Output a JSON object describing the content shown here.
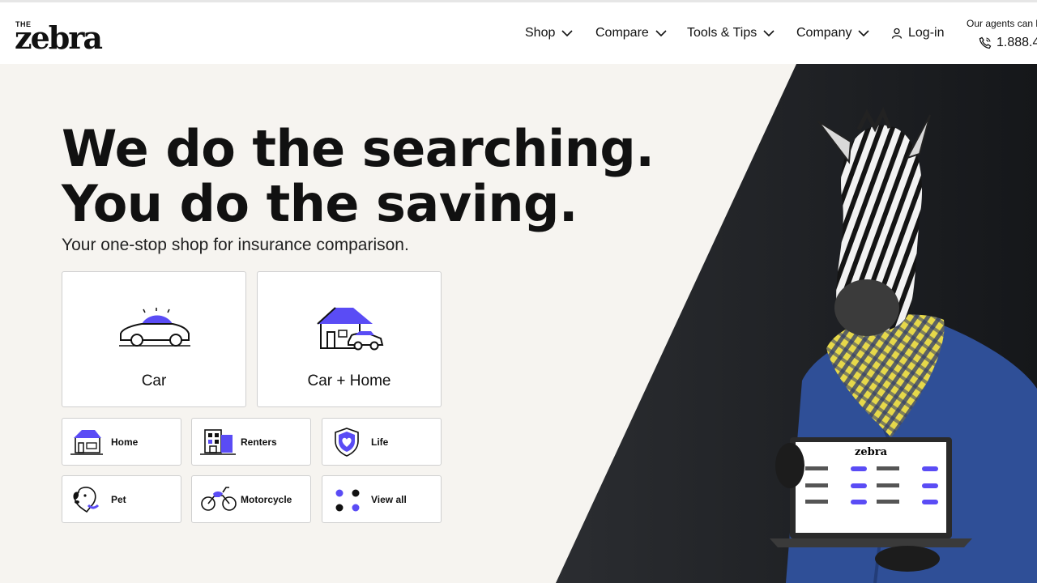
{
  "header": {
    "logo_the": "THE",
    "logo_word": "zebra",
    "nav": [
      {
        "label": "Shop"
      },
      {
        "label": "Compare"
      },
      {
        "label": "Tools & Tips"
      },
      {
        "label": "Company"
      }
    ],
    "login_label": "Log-in",
    "agents_text": "Our agents can he",
    "phone": "1.888.4"
  },
  "hero": {
    "headline_line1": "We do the searching.",
    "headline_line2": "You do the saving.",
    "subtitle": "Your one-stop shop for insurance comparison."
  },
  "products_big": [
    {
      "label": "Car",
      "icon": "car-icon"
    },
    {
      "label": "Car + Home",
      "icon": "car-home-icon"
    }
  ],
  "products_small": [
    {
      "label": "Home",
      "icon": "home-icon"
    },
    {
      "label": "Renters",
      "icon": "renters-icon"
    },
    {
      "label": "Life",
      "icon": "life-shield-icon"
    },
    {
      "label": "Pet",
      "icon": "pet-icon"
    },
    {
      "label": "Motorcycle",
      "icon": "motorcycle-icon"
    },
    {
      "label": "View all",
      "icon": "view-all-icon"
    }
  ],
  "laptop": {
    "logo_word": "zebra"
  },
  "colors": {
    "accent": "#5a4cf5",
    "dark_bg": "#1e2024",
    "hero_bg": "#f6f4f0"
  }
}
